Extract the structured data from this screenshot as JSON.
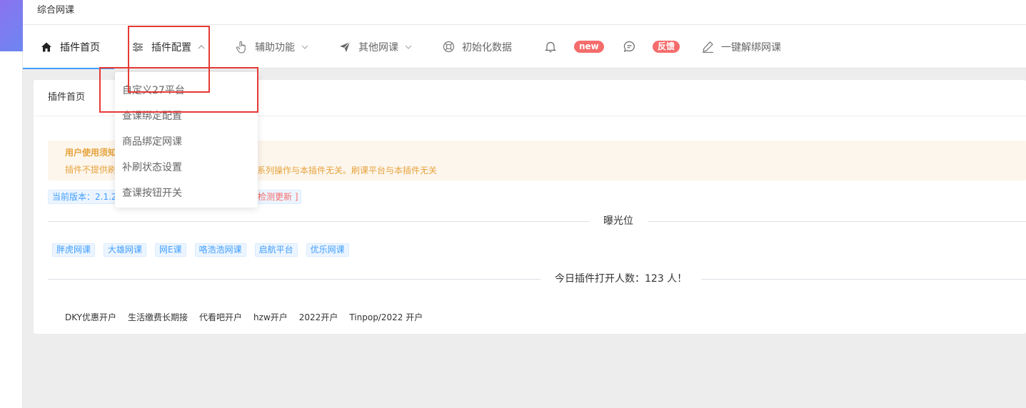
{
  "app": {
    "title": "综合网课"
  },
  "nav": {
    "home": "插件首页",
    "config": "插件配置",
    "assist": "辅助功能",
    "other": "其他网课",
    "init": "初始化数据",
    "bell_badge": "new",
    "feedback_badge": "反馈",
    "unbind": "一键解绑网课"
  },
  "dropdown": {
    "items": [
      "自定义27平台",
      "查课绑定配置",
      "商品绑定网课",
      "补刷状态设置",
      "查课按钮开关"
    ]
  },
  "card": {
    "tab": "插件首页",
    "notice_title": "用户使用须知",
    "notice_text": "插件不提供刷",
    "notice_tail": "系列操作与本插件无关。刷课平台与本插件无关",
    "version": "当前版本：2.1.2",
    "check_update": "检测更新 ]",
    "exposure_label": "曝光位",
    "tags": [
      "胖虎网课",
      "大雄网课",
      "网E课",
      "咯浩浩网课",
      "启航平台",
      "优乐网课"
    ],
    "today_label": "今日插件打开人数：123 人！",
    "links": [
      "DKY优惠开户",
      "生活缴费长期接",
      "代看吧开户",
      "hzw开户",
      "2022开户",
      "Tinpop/2022 开户"
    ]
  },
  "colors": {
    "accent": "#409eff",
    "danger": "#f56c6c",
    "warning": "#e6a23c",
    "highlight": "#e53935"
  },
  "icons": [
    "home-icon",
    "sliders-icon",
    "hand-pointer-icon",
    "paper-plane-icon",
    "lifebuoy-icon",
    "bell-icon",
    "chat-icon",
    "pen-icon",
    "chevron-down-icon",
    "chevron-up-icon"
  ]
}
